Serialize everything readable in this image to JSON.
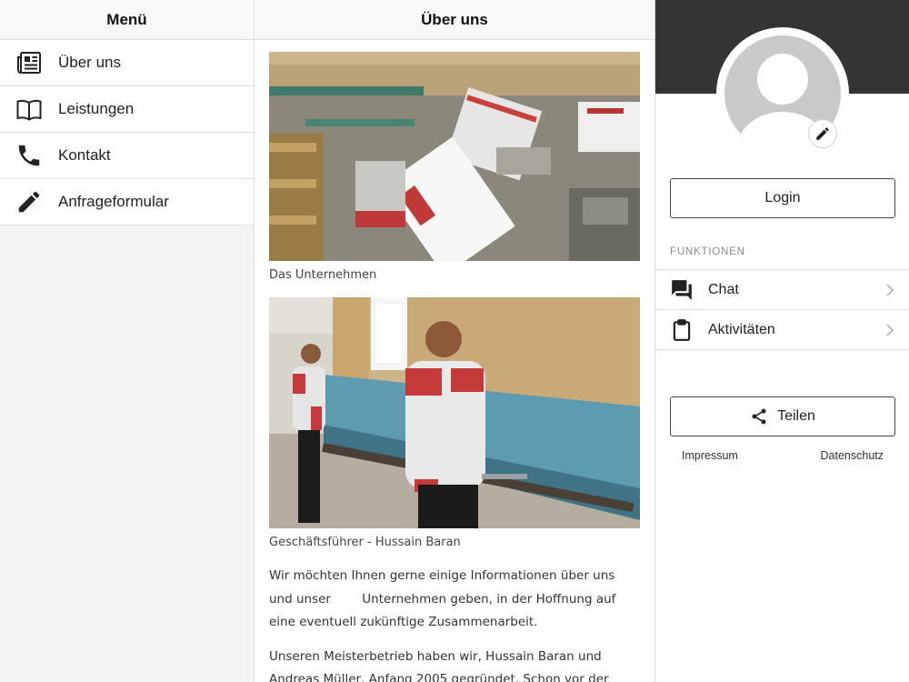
{
  "menu": {
    "title": "Menü",
    "items": [
      {
        "label": "Über uns",
        "icon": "newspaper-icon"
      },
      {
        "label": "Leistungen",
        "icon": "book-icon"
      },
      {
        "label": "Kontakt",
        "icon": "phone-icon"
      },
      {
        "label": "Anfrageformular",
        "icon": "pencil-icon"
      }
    ]
  },
  "content": {
    "title": "Über uns",
    "caption1": "Das Unternehmen",
    "caption2": "Geschäftsführer - Hussain Baran",
    "paragraph1": "Wir möchten Ihnen gerne einige Informationen über uns\nund unser        Unternehmen geben, in der Hoffnung auf\neine eventuell zukünftige Zusammenarbeit.",
    "paragraph2": "Unseren Meisterbetrieb haben wir, Hussain Baran und\nAndreas Müller, Anfang 2005 gegründet. Schon vor der"
  },
  "profile": {
    "login_label": "Login",
    "section_title": "FUNKTIONEN",
    "functions": [
      {
        "label": "Chat",
        "icon": "chat-icon"
      },
      {
        "label": "Aktivitäten",
        "icon": "clipboard-icon"
      }
    ],
    "share_label": "Teilen",
    "impressum_label": "Impressum",
    "datenschutz_label": "Datenschutz"
  },
  "colors": {
    "banner": "#343434",
    "panel_bg": "#f3f3f3",
    "divider": "#dcdcdc"
  }
}
